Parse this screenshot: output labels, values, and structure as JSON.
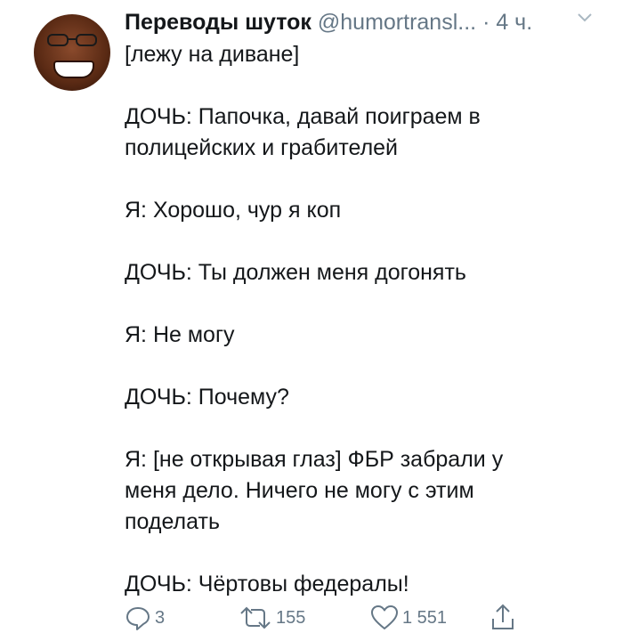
{
  "tweet": {
    "author_name": "Переводы шуток",
    "author_handle": "@humortransl...",
    "time": "· 4 ч.",
    "lines": [
      "[лежу на диване]",
      "",
      "ДОЧЬ: Папочка, давай поиграем в",
      "полицейских и грабителей",
      "",
      "Я: Хорошо, чур я коп",
      "",
      "ДОЧЬ: Ты должен меня догонять",
      "",
      "Я: Не могу",
      "",
      "ДОЧЬ: Почему?",
      "",
      "Я: [не открывая глаз] ФБР забрали у",
      "меня дело. Ничего не могу с этим",
      "поделать",
      "",
      "ДОЧЬ: Чёртовы федералы!"
    ]
  },
  "actions": {
    "reply_count": "3",
    "retweet_count": "155",
    "like_count": "1 551"
  },
  "icons": {
    "reply": "reply-icon",
    "retweet": "retweet-icon",
    "like": "heart-icon",
    "share": "share-icon",
    "menu": "chevron-down-icon"
  },
  "colors": {
    "muted": "#657786",
    "text": "#14171a"
  }
}
